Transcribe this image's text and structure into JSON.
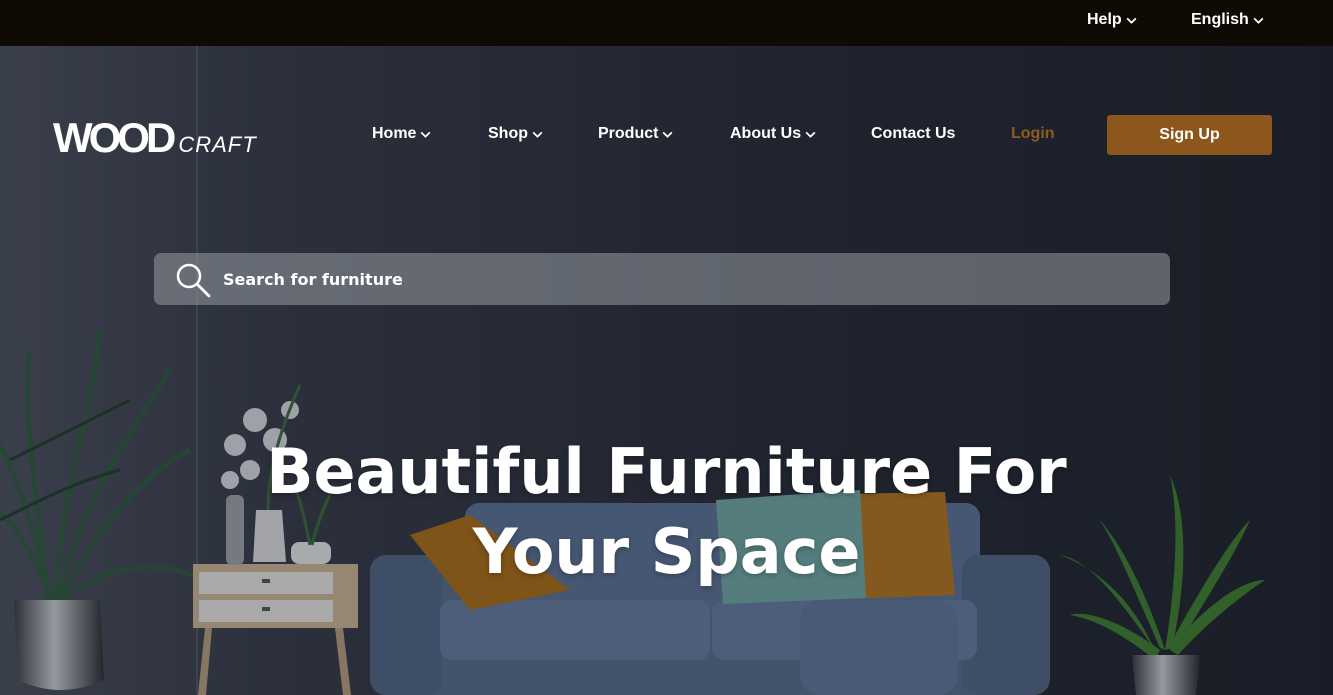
{
  "topbar": {
    "help_label": "Help",
    "language_label": "English",
    "background": "#100a04"
  },
  "brand": {
    "logo_main": "WOOD",
    "logo_sub": "CRAFT"
  },
  "nav": {
    "items": [
      {
        "label": "Home",
        "dropdown": true
      },
      {
        "label": "Shop",
        "dropdown": true
      },
      {
        "label": "Product",
        "dropdown": true
      },
      {
        "label": "About Us",
        "dropdown": true
      },
      {
        "label": "Contact Us",
        "dropdown": false
      }
    ],
    "login_label": "Login",
    "signup_label": "Sign Up",
    "accent_color": "#8b571c"
  },
  "search": {
    "placeholder": "Search for furniture",
    "icon": "search-icon"
  },
  "hero": {
    "headline_line1": "Beautiful Furniture For",
    "headline_line2": "Your Space"
  }
}
